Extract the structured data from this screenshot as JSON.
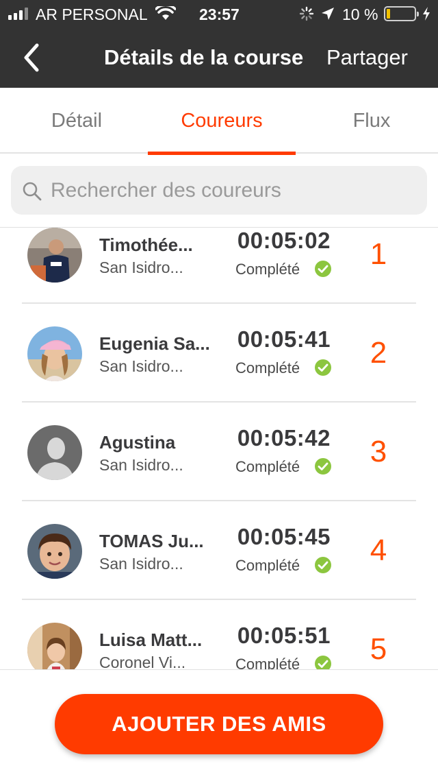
{
  "status_bar": {
    "carrier": "AR PERSONAL",
    "time": "23:57",
    "battery_percent": "10 %",
    "battery_level": 0.1,
    "signal_bars_active": 3,
    "signal_bars_total": 4
  },
  "nav": {
    "title": "Détails de la course",
    "share_label": "Partager"
  },
  "tabs": [
    {
      "label": "Détail",
      "active": false
    },
    {
      "label": "Coureurs",
      "active": true
    },
    {
      "label": "Flux",
      "active": false
    }
  ],
  "search": {
    "placeholder": "Rechercher des coureurs"
  },
  "runners": [
    {
      "name": "Timothée...",
      "city": "San Isidro...",
      "time": "00:05:02",
      "status": "Complété",
      "rank": "1"
    },
    {
      "name": "Eugenia Sa...",
      "city": "San Isidro...",
      "time": "00:05:41",
      "status": "Complété",
      "rank": "2"
    },
    {
      "name": "Agustina",
      "city": "San Isidro...",
      "time": "00:05:42",
      "status": "Complété",
      "rank": "3"
    },
    {
      "name": "TOMAS Ju...",
      "city": "San Isidro...",
      "time": "00:05:45",
      "status": "Complété",
      "rank": "4"
    },
    {
      "name": "Luisa Matt...",
      "city": "Coronel Vi...",
      "time": "00:05:51",
      "status": "Complété",
      "rank": "5"
    }
  ],
  "cta": {
    "label": "AJOUTER DES AMIS"
  },
  "colors": {
    "accent": "#ff3b00",
    "rank": "#ff5000",
    "complete_check": "#8cc63f",
    "header_bg": "#333333"
  }
}
